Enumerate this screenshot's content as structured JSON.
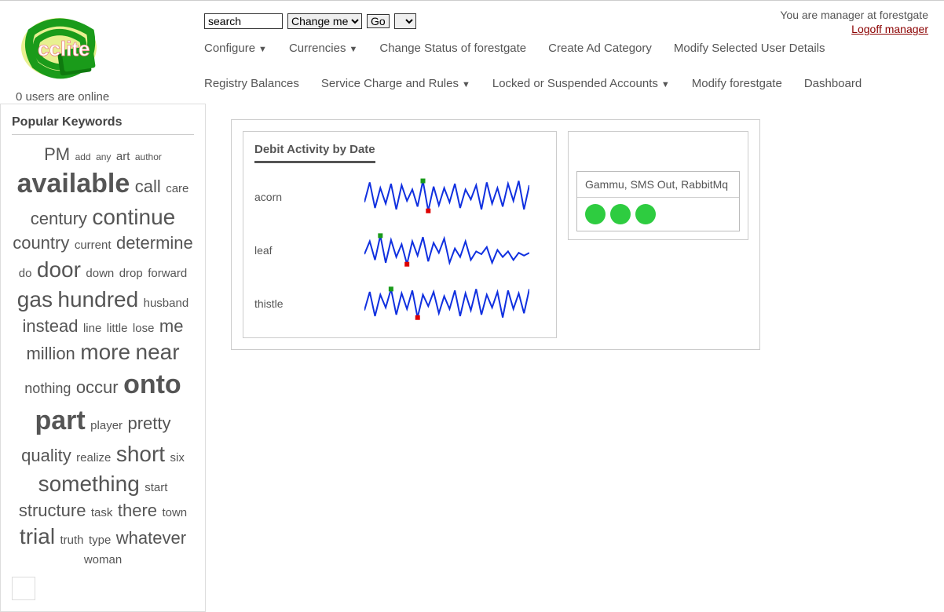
{
  "header": {
    "app_name": "cclite",
    "users_online": "0 users are online",
    "search_value": "search",
    "select_label": "Change me",
    "go_label": "Go",
    "status_text": "You are manager at forestgate",
    "logoff_label": "Logoff manager"
  },
  "nav": [
    {
      "label": "Configure",
      "dropdown": true
    },
    {
      "label": "Currencies",
      "dropdown": true
    },
    {
      "label": "Change Status of forestgate",
      "dropdown": false
    },
    {
      "label": "Create Ad Category",
      "dropdown": false
    },
    {
      "label": "Modify Selected User Details",
      "dropdown": false
    },
    {
      "label": "Registry Balances",
      "dropdown": false
    },
    {
      "label": "Service Charge and Rules",
      "dropdown": true
    },
    {
      "label": "Locked or Suspended Accounts",
      "dropdown": true
    },
    {
      "label": "Modify forestgate",
      "dropdown": false
    },
    {
      "label": "Dashboard",
      "dropdown": false
    }
  ],
  "sidebar": {
    "title": "Popular Keywords",
    "keywords": [
      {
        "t": "PM",
        "s": 4
      },
      {
        "t": "add",
        "s": 1
      },
      {
        "t": "any",
        "s": 1
      },
      {
        "t": "art",
        "s": 2
      },
      {
        "t": "author",
        "s": 1
      },
      {
        "t": "available",
        "s": 6
      },
      {
        "t": "call",
        "s": 4
      },
      {
        "t": "care",
        "s": 2
      },
      {
        "t": "century",
        "s": 4
      },
      {
        "t": "continue",
        "s": 5
      },
      {
        "t": "country",
        "s": 4
      },
      {
        "t": "current",
        "s": 2
      },
      {
        "t": "determine",
        "s": 4
      },
      {
        "t": "do",
        "s": 2
      },
      {
        "t": "door",
        "s": 5
      },
      {
        "t": "down",
        "s": 2
      },
      {
        "t": "drop",
        "s": 2
      },
      {
        "t": "forward",
        "s": 2
      },
      {
        "t": "gas",
        "s": 5
      },
      {
        "t": "hundred",
        "s": 5
      },
      {
        "t": "husband",
        "s": 2
      },
      {
        "t": "instead",
        "s": 4
      },
      {
        "t": "line",
        "s": 2
      },
      {
        "t": "little",
        "s": 2
      },
      {
        "t": "lose",
        "s": 2
      },
      {
        "t": "me",
        "s": 4
      },
      {
        "t": "million",
        "s": 4
      },
      {
        "t": "more",
        "s": 5
      },
      {
        "t": "near",
        "s": 5
      },
      {
        "t": "nothing",
        "s": 3
      },
      {
        "t": "occur",
        "s": 4
      },
      {
        "t": "onto",
        "s": 6
      },
      {
        "t": "part",
        "s": 6
      },
      {
        "t": "player",
        "s": 2
      },
      {
        "t": "pretty",
        "s": 4
      },
      {
        "t": "quality",
        "s": 4
      },
      {
        "t": "realize",
        "s": 2
      },
      {
        "t": "short",
        "s": 5
      },
      {
        "t": "six",
        "s": 2
      },
      {
        "t": "something",
        "s": 5
      },
      {
        "t": "start",
        "s": 2
      },
      {
        "t": "structure",
        "s": 4
      },
      {
        "t": "task",
        "s": 2
      },
      {
        "t": "there",
        "s": 4
      },
      {
        "t": "town",
        "s": 2
      },
      {
        "t": "trial",
        "s": 5
      },
      {
        "t": "truth",
        "s": 2
      },
      {
        "t": "type",
        "s": 2
      },
      {
        "t": "whatever",
        "s": 4
      },
      {
        "t": "woman",
        "s": 2
      }
    ]
  },
  "dashboard": {
    "chart_title": "Debit Activity by Date",
    "status_head": "Gammu, SMS Out, RabbitMq",
    "status_count": 3
  },
  "chart_data": [
    {
      "type": "line",
      "title": "acorn",
      "x": "date (unlabeled)",
      "y": "debit activity (unlabeled)",
      "values": [
        20,
        48,
        12,
        40,
        18,
        46,
        10,
        44,
        22,
        38,
        14,
        50,
        8,
        42,
        16,
        40,
        20,
        46,
        12,
        38,
        24,
        44,
        10,
        48,
        18,
        40,
        14,
        46,
        22,
        50,
        10,
        44
      ],
      "ylim": [
        0,
        55
      ]
    },
    {
      "type": "line",
      "title": "leaf",
      "x": "date (unlabeled)",
      "y": "debit activity (unlabeled)",
      "values": [
        22,
        40,
        14,
        48,
        10,
        42,
        18,
        36,
        8,
        40,
        20,
        46,
        12,
        38,
        24,
        44,
        10,
        30,
        18,
        40,
        14,
        26,
        22,
        32,
        10,
        28,
        18,
        26,
        14,
        24,
        20,
        24
      ],
      "ylim": [
        0,
        55
      ]
    },
    {
      "type": "line",
      "title": "thistle",
      "x": "date (unlabeled)",
      "y": "debit activity (unlabeled)",
      "values": [
        18,
        44,
        10,
        40,
        22,
        48,
        12,
        42,
        20,
        46,
        8,
        40,
        24,
        44,
        14,
        38,
        20,
        46,
        10,
        42,
        18,
        48,
        12,
        40,
        22,
        44,
        8,
        46,
        20,
        42,
        14,
        48
      ],
      "ylim": [
        0,
        55
      ]
    }
  ]
}
